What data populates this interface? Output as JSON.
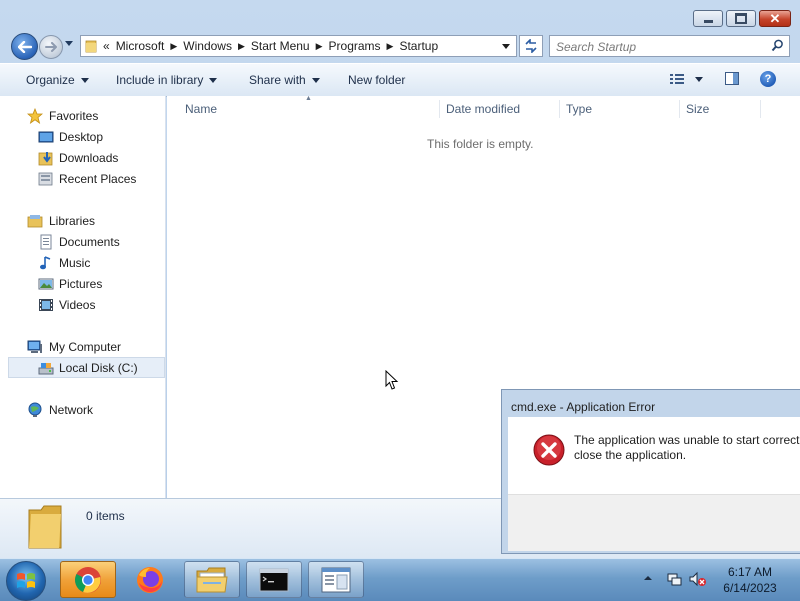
{
  "window": {
    "caption_buttons": {
      "minimize_icon": "minimize-icon",
      "maximize_icon": "maximize-icon",
      "close_icon": "close-icon"
    }
  },
  "navbar": {
    "overflow_glyph": "«",
    "breadcrumbs": [
      "Microsoft",
      "Windows",
      "Start Menu",
      "Programs",
      "Startup"
    ],
    "search_placeholder": "Search Startup"
  },
  "toolbar": {
    "organize": "Organize",
    "include_in_library": "Include in library",
    "share_with": "Share with",
    "new_folder": "New folder",
    "help": "?"
  },
  "sidebar": {
    "favorites": {
      "label": "Favorites",
      "items": [
        "Desktop",
        "Downloads",
        "Recent Places"
      ]
    },
    "libraries": {
      "label": "Libraries",
      "items": [
        "Documents",
        "Music",
        "Pictures",
        "Videos"
      ]
    },
    "computer": {
      "label": "My Computer",
      "items": [
        "Local Disk (C:)"
      ]
    },
    "network": {
      "label": "Network"
    }
  },
  "content": {
    "columns": [
      "Name",
      "Date modified",
      "Type",
      "Size"
    ],
    "empty_message": "This folder is empty."
  },
  "details": {
    "item_count": "0 items"
  },
  "dialog": {
    "title": "cmd.exe - Application Error",
    "message_line1": "The application was unable to start correctly",
    "message_line2": "close the application."
  },
  "taskbar": {
    "pinned": [
      "chrome-icon",
      "firefox-icon",
      "explorer-icon",
      "cmd-icon",
      "window-app-icon"
    ],
    "clock_time": "6:17 AM",
    "clock_date": "6/14/2023"
  },
  "colors": {
    "window_frame": "#c5d9ef",
    "selection_bg": "#e6eef8",
    "active_taskbar": "#f0a23a",
    "error_red": "#c8202a"
  }
}
